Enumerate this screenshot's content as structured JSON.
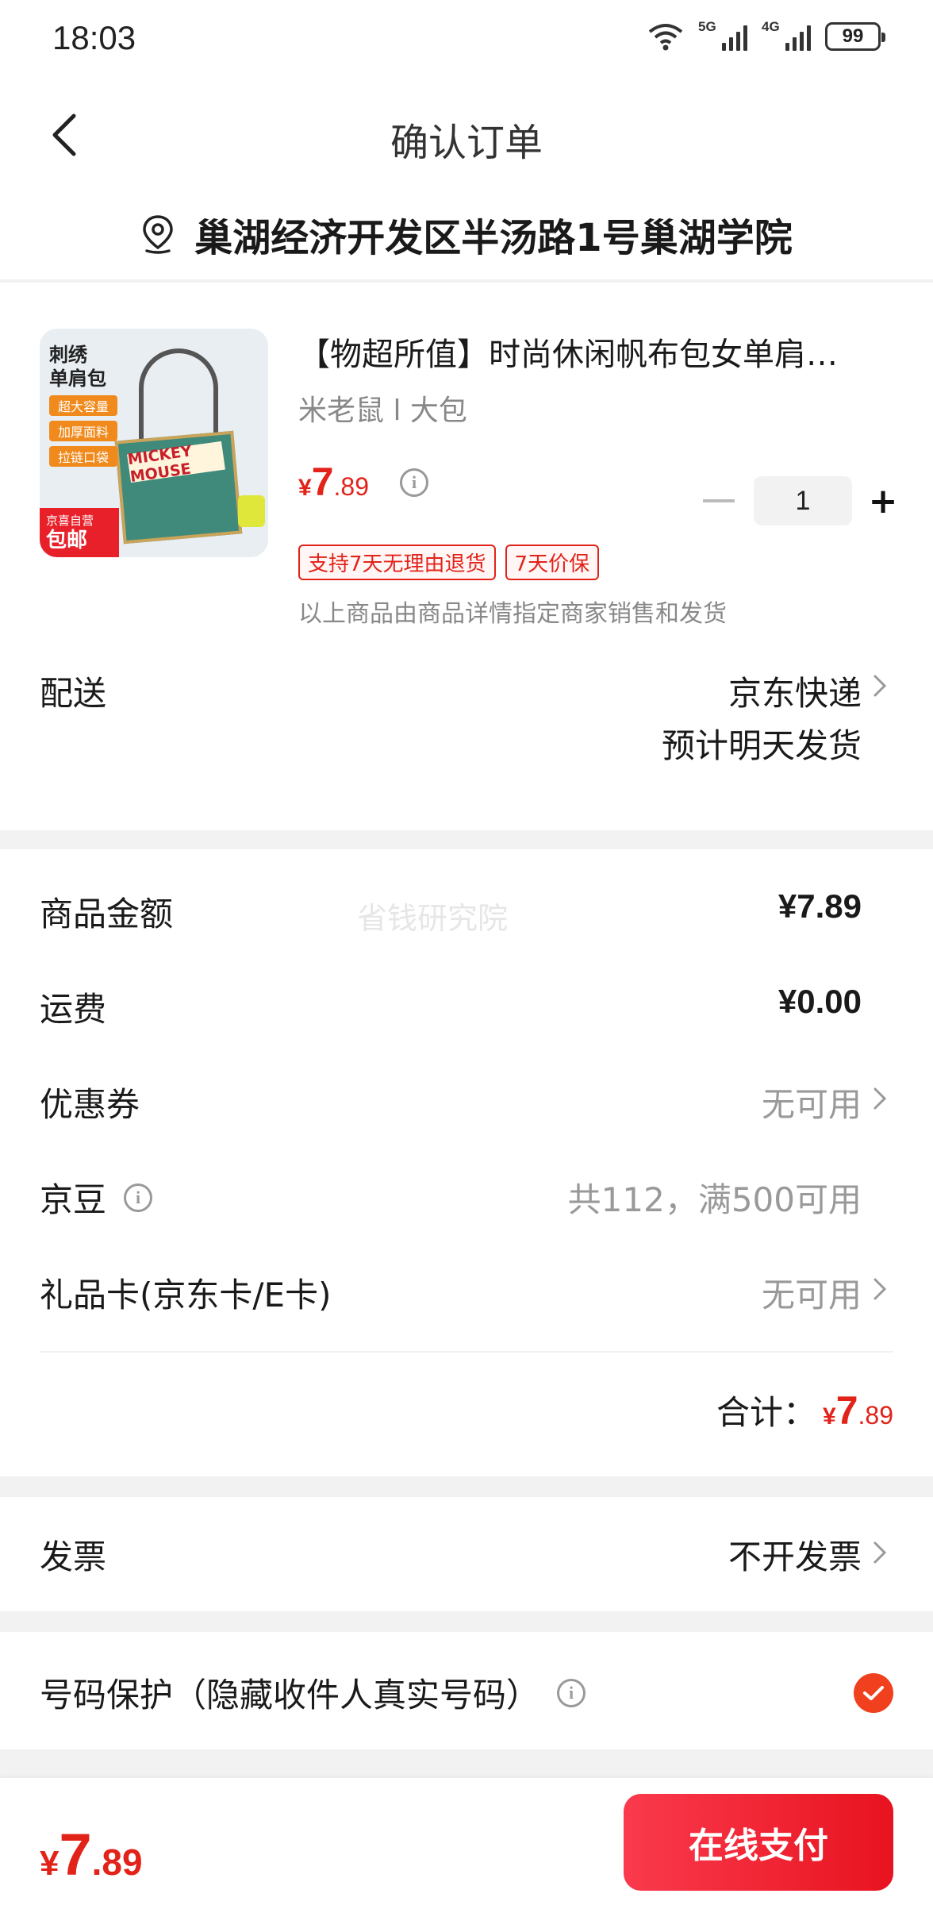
{
  "status_bar": {
    "time": "18:03",
    "net1": "5G",
    "net2": "4G",
    "battery": "99"
  },
  "header": {
    "title": "确认订单",
    "address": "巢湖经济开发区半汤路1号巢湖学院"
  },
  "product": {
    "image": {
      "line1": "刺绣",
      "line2": "单肩包",
      "pills": [
        "超大容量",
        "加厚面料",
        "拉链口袋"
      ],
      "jd_label": "京喜自营",
      "free_ship": "包邮",
      "art_text": "MICKEY MOUSE"
    },
    "title": "【物超所值】时尚休闲帆布包女单肩…",
    "spec": "米老鼠 l 大包",
    "price": {
      "currency": "¥",
      "int": "7",
      "dec": ".89"
    },
    "quantity": "1",
    "service_tags": [
      "支持7天无理由退货",
      "7天价保"
    ],
    "seller_note": "以上商品由商品详情指定商家销售和发货"
  },
  "delivery": {
    "label": "配送",
    "carrier": "京东快递",
    "eta": "预计明天发货"
  },
  "amounts": {
    "watermark": "省钱研究院",
    "goods_label": "商品金额",
    "goods_value": "¥7.89",
    "shipping_label": "运费",
    "shipping_value": "¥0.00",
    "coupon_label": "优惠券",
    "coupon_value": "无可用",
    "beans_label": "京豆",
    "beans_value": "共112，满500可用",
    "giftcard_label": "礼品卡(京东卡/E卡)",
    "giftcard_value": "无可用",
    "total_label": "合计：",
    "total": {
      "currency": "¥",
      "int": "7",
      "dec": ".89"
    }
  },
  "invoice": {
    "label": "发票",
    "value": "不开发票"
  },
  "privacy": {
    "label": "号码保护（隐藏收件人真实号码）",
    "checked": true
  },
  "footer": {
    "price": {
      "currency": "¥",
      "int": "7",
      "dec": ".89"
    },
    "pay_label": "在线支付"
  },
  "colors": {
    "accent": "#e2231a",
    "pay_start": "#fa3a4d",
    "pay_end": "#e8131f",
    "check": "#f0401e"
  }
}
